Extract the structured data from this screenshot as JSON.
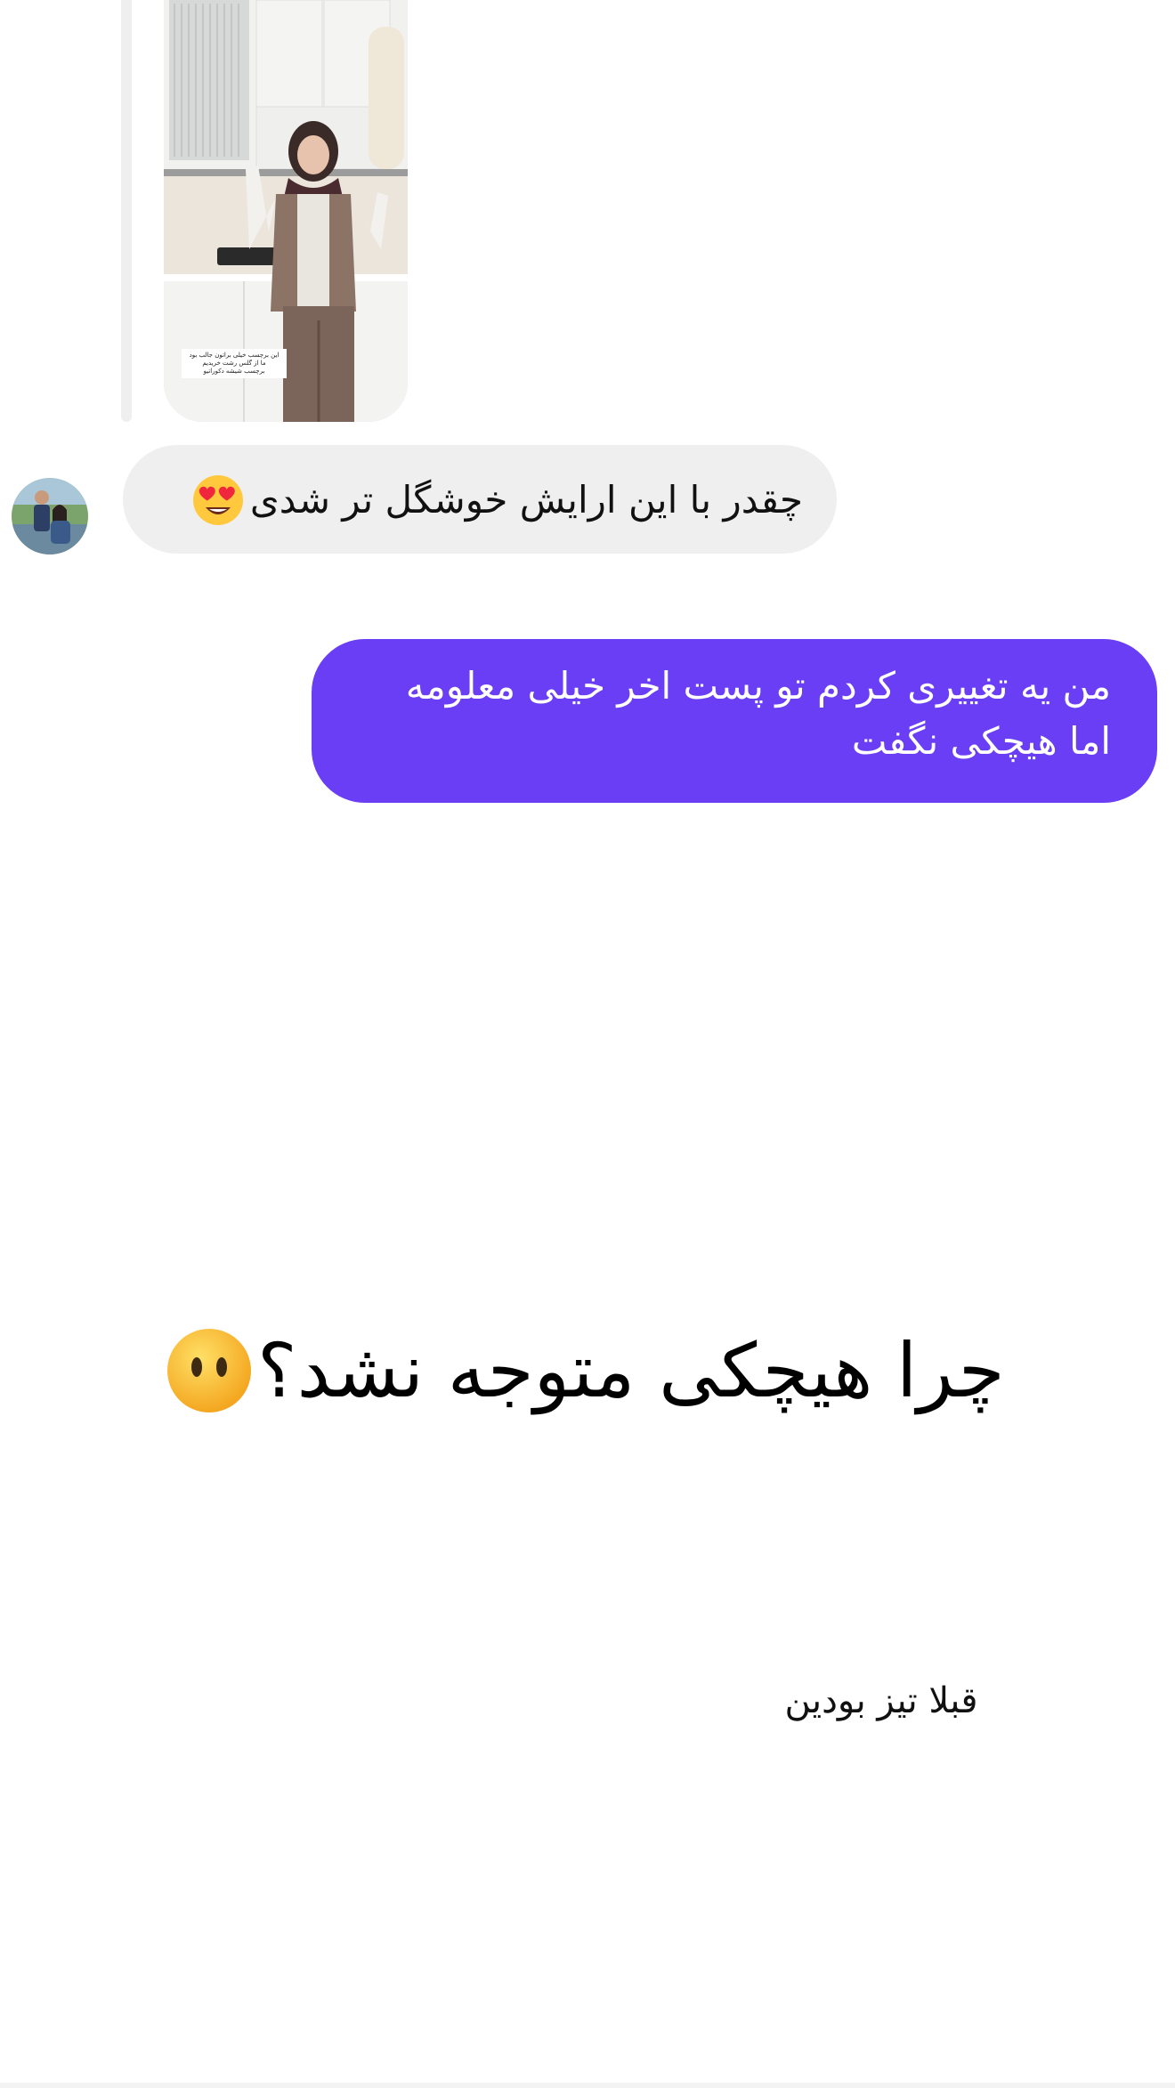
{
  "shared_post": {
    "caption_lines": [
      "این برچسب خیلی براتون جالب بود",
      "ما از گلس رشت خریدیم",
      "برچسب شیشه دکوراتیو"
    ]
  },
  "messages": [
    {
      "direction": "incoming",
      "text": "چقدر با این ارایش خوشگل تر شدی",
      "emoji": "heart-eyes-emoji"
    },
    {
      "direction": "outgoing",
      "lines": [
        "من یه تغییری کردم تو پست اخر خیلی معلومه",
        "اما هیچکی نگفت"
      ]
    }
  ],
  "overlay": {
    "headline": "چرا هیچکی متوجه نشد؟",
    "headline_emoji": "face-without-mouth-emoji",
    "subline": "قبلا تیز بودین"
  },
  "colors": {
    "outgoing_bubble": "#6a3ef5",
    "incoming_bubble": "#efefef",
    "background": "#ffffff"
  }
}
